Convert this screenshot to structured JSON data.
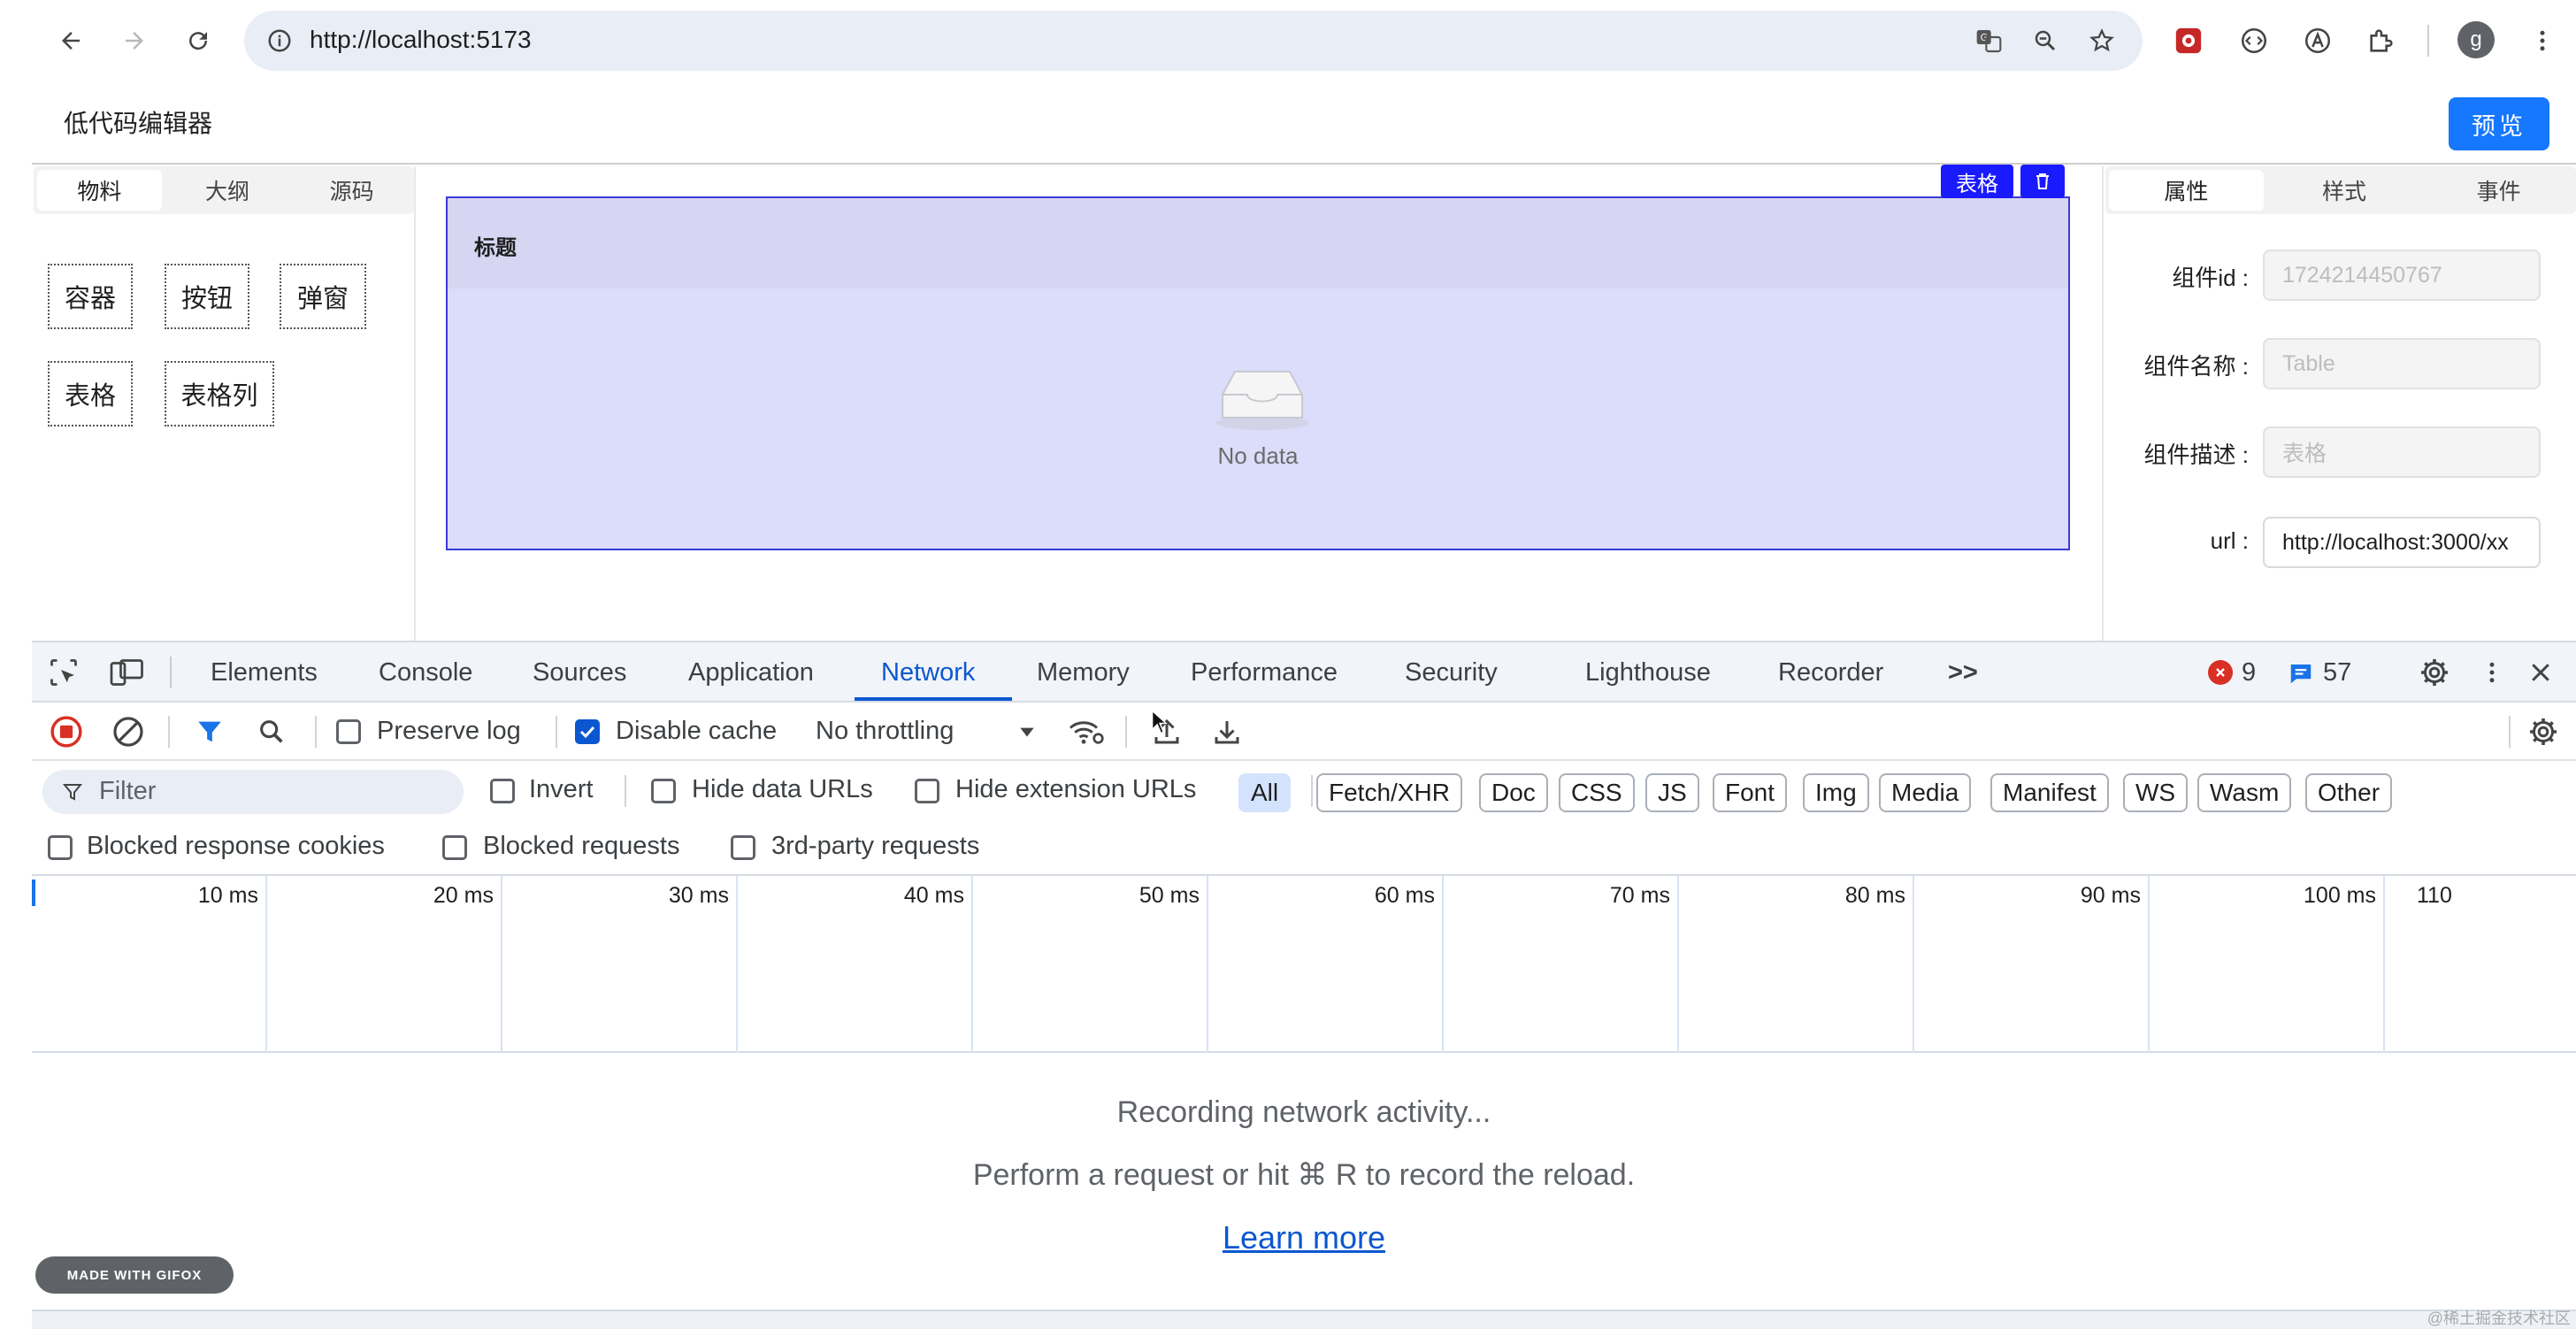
{
  "browser": {
    "url": "http://localhost:5173",
    "profile_initial": "g"
  },
  "app": {
    "title": "低代码编辑器",
    "preview_label": "预览"
  },
  "left_panel": {
    "tabs": [
      "物料",
      "大纲",
      "源码"
    ],
    "active_tab": "物料",
    "materials": [
      "容器",
      "按钮",
      "弹窗",
      "表格",
      "表格列"
    ]
  },
  "canvas": {
    "selected_label": "表格",
    "table_header": "标题",
    "empty_text": "No data"
  },
  "right_panel": {
    "tabs": [
      "属性",
      "样式",
      "事件"
    ],
    "active_tab": "属性",
    "fields": [
      {
        "label": "组件id :",
        "value": "1724214450767"
      },
      {
        "label": "组件名称 :",
        "value": "Table"
      },
      {
        "label": "组件描述 :",
        "value": "表格"
      },
      {
        "label": "url :",
        "value": "http://localhost:3000/xx"
      }
    ]
  },
  "devtools": {
    "tabs": [
      "Elements",
      "Console",
      "Sources",
      "Application",
      "Network",
      "Memory",
      "Performance",
      "Security",
      "Lighthouse",
      "Recorder"
    ],
    "active_tab": "Network",
    "more_label": ">>",
    "error_count": "9",
    "message_count": "57",
    "toolbar": {
      "preserve_log": "Preserve log",
      "disable_cache": "Disable cache",
      "throttling": "No throttling"
    },
    "filter": {
      "placeholder": "Filter",
      "invert": "Invert",
      "hide_data_urls": "Hide data URLs",
      "hide_extension_urls": "Hide extension URLs",
      "types": [
        "All",
        "Fetch/XHR",
        "Doc",
        "CSS",
        "JS",
        "Font",
        "Img",
        "Media",
        "Manifest",
        "WS",
        "Wasm",
        "Other"
      ],
      "active_type": "All"
    },
    "filter_row2": {
      "blocked_cookies": "Blocked response cookies",
      "blocked_requests": "Blocked requests",
      "third_party": "3rd-party requests"
    },
    "timeline_ticks": [
      "10 ms",
      "20 ms",
      "30 ms",
      "40 ms",
      "50 ms",
      "60 ms",
      "70 ms",
      "80 ms",
      "90 ms",
      "100 ms",
      "110"
    ],
    "empty": {
      "line1": "Recording network activity...",
      "line2": "Perform a request or hit ⌘ R to record the reload.",
      "link": "Learn more"
    }
  },
  "overlay": {
    "gifox": "MADE WITH GIFOX",
    "watermark": "@稀土掘金技术社区"
  },
  "colors": {
    "accent": "#1677ff",
    "selection": "#1a1aff",
    "devtools_blue": "#0b57d0",
    "error": "#d93025"
  }
}
